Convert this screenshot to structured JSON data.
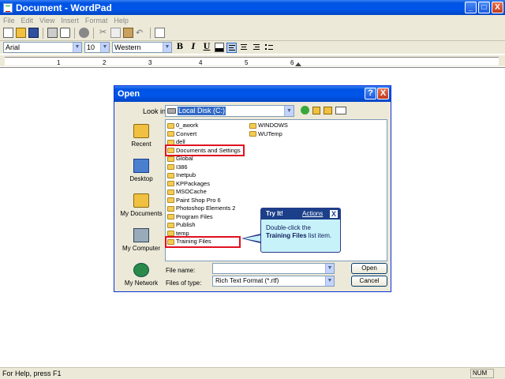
{
  "window": {
    "title": "Document - WordPad",
    "minimize": "_",
    "maximize": "□",
    "close": "X"
  },
  "menu": [
    "File",
    "Edit",
    "View",
    "Insert",
    "Format",
    "Help"
  ],
  "format_bar": {
    "font": "Arial",
    "size": "10",
    "script": "Western",
    "bold": "B",
    "italic": "I",
    "underline": "U"
  },
  "ruler": {
    "numbers": [
      "1",
      "2",
      "3",
      "4",
      "5",
      "6"
    ]
  },
  "status": {
    "help_text": "For Help, press F1",
    "num": "NUM"
  },
  "dialog": {
    "title": "Open",
    "help": "?",
    "close": "X",
    "look_in_label": "Look in:",
    "look_in_value": "Local Disk (C:)",
    "places": [
      "Recent",
      "Desktop",
      "My Documents",
      "My Computer",
      "My Network"
    ],
    "files_col1": [
      "0_awork",
      "Convert",
      "dell",
      "Documents and Settings",
      "Global",
      "I386",
      "Inetpub",
      "KPPackages",
      "MSOCache",
      "Paint Shop Pro 6",
      "Photoshop Elements 2",
      "Program Files",
      "Publish",
      "temp",
      "Training Files"
    ],
    "files_col2": [
      "WINDOWS",
      "WUTemp"
    ],
    "file_name_label": "File name:",
    "file_name_value": "",
    "file_type_label": "Files of type:",
    "file_type_value": "Rich Text Format (*.rtf)",
    "open_button": "Open",
    "cancel_button": "Cancel"
  },
  "callout": {
    "title": "Try It!",
    "actions": "Actions",
    "close": "X",
    "body_line1": "Double-click the",
    "body_bold": "Training Files",
    "body_line2": " list item."
  },
  "colors": {
    "titlebar": "#0054e3",
    "highlight_box": "#e01020",
    "callout_bg": "#c8f2fa",
    "callout_header": "#1c3f8a"
  }
}
